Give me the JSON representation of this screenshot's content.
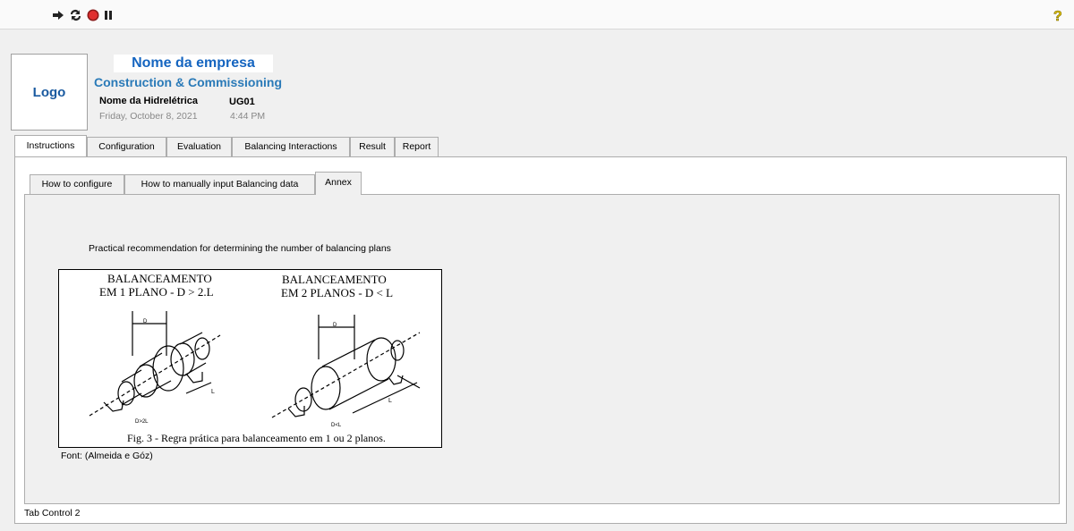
{
  "toolbar": {
    "icons": [
      "run-arrow-icon",
      "run-continuous-icon",
      "abort-icon",
      "pause-icon",
      "help-icon"
    ]
  },
  "header": {
    "logo": "Logo",
    "company": "Nome da empresa",
    "department": "Construction & Commissioning",
    "plant": "Nome da Hidrelétrica",
    "unit": "UG01",
    "date": "Friday, October 8, 2021",
    "time": "4:44 PM"
  },
  "main_tabs": [
    {
      "label": "Instructions",
      "active": true
    },
    {
      "label": "Configuration",
      "active": false
    },
    {
      "label": "Evaluation",
      "active": false
    },
    {
      "label": "Balancing Interactions",
      "active": false
    },
    {
      "label": "Result",
      "active": false
    },
    {
      "label": "Report",
      "active": false
    }
  ],
  "inner_tabs": [
    {
      "label": "How to configure",
      "active": false
    },
    {
      "label": "How to manually input Balancing data",
      "active": false
    },
    {
      "label": "Annex",
      "active": true
    }
  ],
  "annex": {
    "heading": "Practical recommendation for determining the number of balancing plans",
    "figure": {
      "left_title_1": "BALANCEAMENTO",
      "left_title_2": "EM 1 PLANO -  D >  2.L",
      "right_title_1": "BALANCEAMENTO",
      "right_title_2": "EM 2 PLANOS -  D < L",
      "left_dim_d": "D",
      "left_dim_l": "L",
      "left_foot": "D>2L",
      "right_dim_d": "D",
      "right_dim_l": "L",
      "right_foot": "D<L",
      "caption": "Fig. 3 - Regra prática para balanceamento em 1 ou 2 planos."
    },
    "source": "Font: (Almeida e Góz)"
  },
  "footer_label": "Tab Control 2"
}
